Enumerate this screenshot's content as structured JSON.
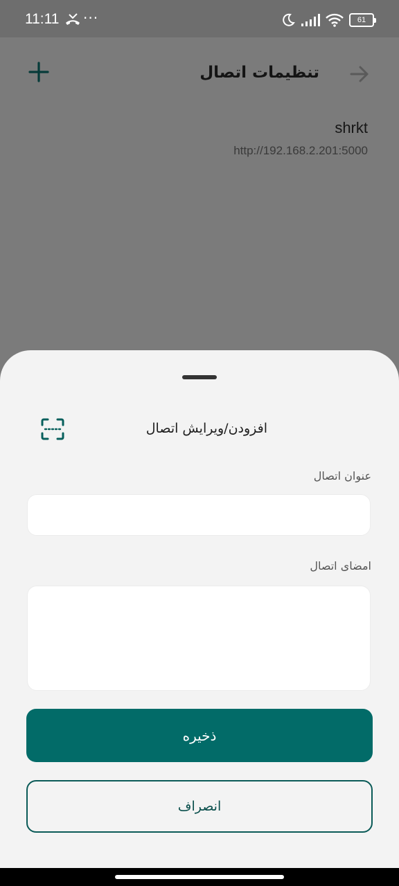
{
  "status_bar": {
    "time": "11:11",
    "dots": "···",
    "battery_level": "61",
    "icons": [
      "missed-call-icon",
      "moon-icon",
      "signal-icon",
      "wifi-icon",
      "battery-icon"
    ]
  },
  "app_bar": {
    "title": "تنظیمات اتصال",
    "icons": [
      "back-arrow-icon",
      "plus-icon"
    ]
  },
  "connections": [
    {
      "name": "shrkt",
      "url": "http://192.168.2.201:5000"
    }
  ],
  "sheet": {
    "title": "افزودن/ویرایش اتصال",
    "scan_icon": "qr-scan-icon",
    "fields": {
      "title_label": "عنوان اتصال",
      "title_value": "",
      "signature_label": "امضای اتصال",
      "signature_value": ""
    },
    "save_label": "ذخیره",
    "cancel_label": "انصراف"
  },
  "colors": {
    "primary": "#026b68",
    "sheet_bg": "#f3f3f3",
    "scrim_bg": "#7b7b7b"
  }
}
